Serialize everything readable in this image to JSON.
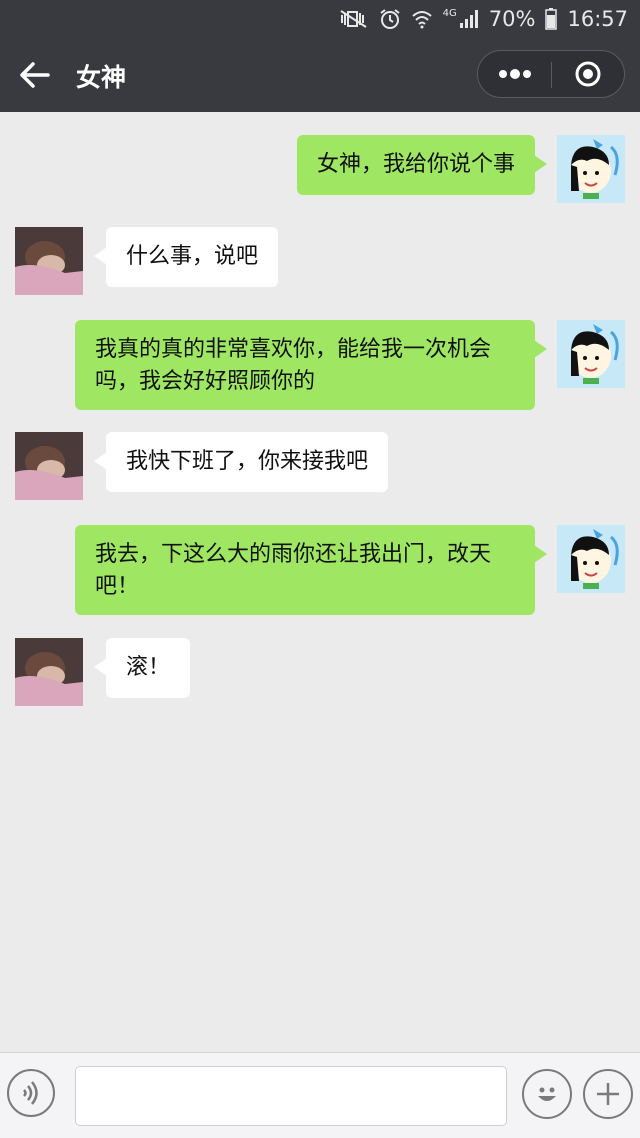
{
  "status_bar": {
    "network": "4G",
    "battery": "70%",
    "time": "16:57",
    "icons": [
      "mute-vibrate-icon",
      "alarm-icon",
      "wifi-icon",
      "signal-icon",
      "battery-icon"
    ]
  },
  "nav": {
    "title": "女神",
    "icons": [
      "back-arrow-icon",
      "more-dots-icon",
      "close-target-icon"
    ]
  },
  "messages": [
    {
      "from": "me",
      "text": "女神，我给你说个事"
    },
    {
      "from": "her",
      "text": "什么事，说吧"
    },
    {
      "from": "me",
      "text": "我真的真的非常喜欢你，能给我一次机会吗，我会好好照顾你的"
    },
    {
      "from": "her",
      "text": "我快下班了，你来接我吧"
    },
    {
      "from": "me",
      "text": "我去，下这么大的雨你还让我出门，改天吧！"
    },
    {
      "from": "her",
      "text": "滚！"
    }
  ],
  "input_bar": {
    "text_value": "",
    "icons": [
      "voice-icon",
      "emoji-icon",
      "plus-icon"
    ]
  },
  "colors": {
    "header_bg": "#393a3f",
    "chat_bg": "#ebebeb",
    "my_bubble": "#9fe763",
    "her_bubble": "#ffffff"
  }
}
